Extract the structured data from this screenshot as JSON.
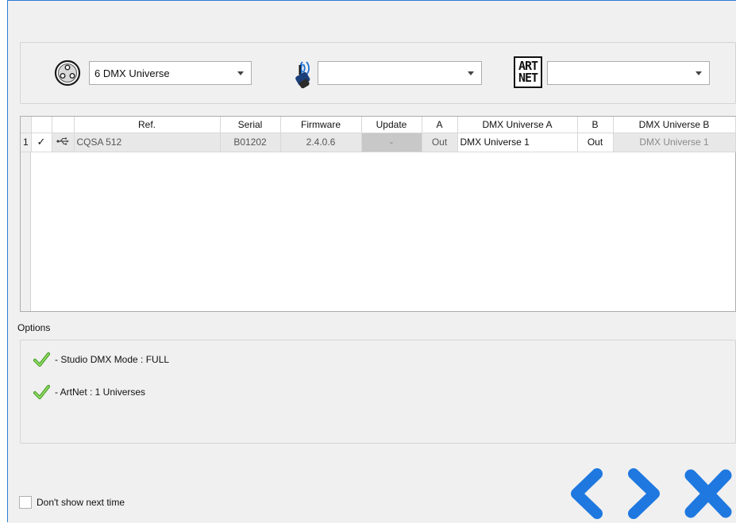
{
  "device_bar": {
    "dmx_universe_select": "6 DMX Universe",
    "wireless_select": "",
    "artnet_select": "",
    "artnet_logo_line1": "ART",
    "artnet_logo_line2": "NET"
  },
  "table": {
    "headers": [
      "Ref.",
      "Serial",
      "Firmware",
      "Update",
      "A",
      "DMX Universe A",
      "B",
      "DMX Universe B"
    ],
    "rows": [
      {
        "row_number": "1",
        "checked": "✓",
        "ref": "CQSA 512",
        "serial": "B01202",
        "firmware": "2.4.0.6",
        "update": "-",
        "a": "Out",
        "dmx_universe_a": "DMX Universe 1",
        "b": "Out",
        "dmx_universe_b": "DMX Universe 1"
      }
    ]
  },
  "options": {
    "label": "Options",
    "items": [
      "- Studio DMX Mode : FULL",
      "- ArtNet : 1 Universes"
    ]
  },
  "footer": {
    "dont_show_label": "Don't show next time"
  },
  "colors": {
    "nav_blue": "#1e78e0",
    "check_green": "#5cb82e"
  },
  "icons": {
    "xlr": "xlr-connector-icon",
    "wireless": "wireless-dongle-icon",
    "usb": "usb-icon",
    "option_ok": "green-check-icon",
    "back": "chevron-left-icon",
    "next": "chevron-right-icon",
    "close": "close-icon"
  }
}
